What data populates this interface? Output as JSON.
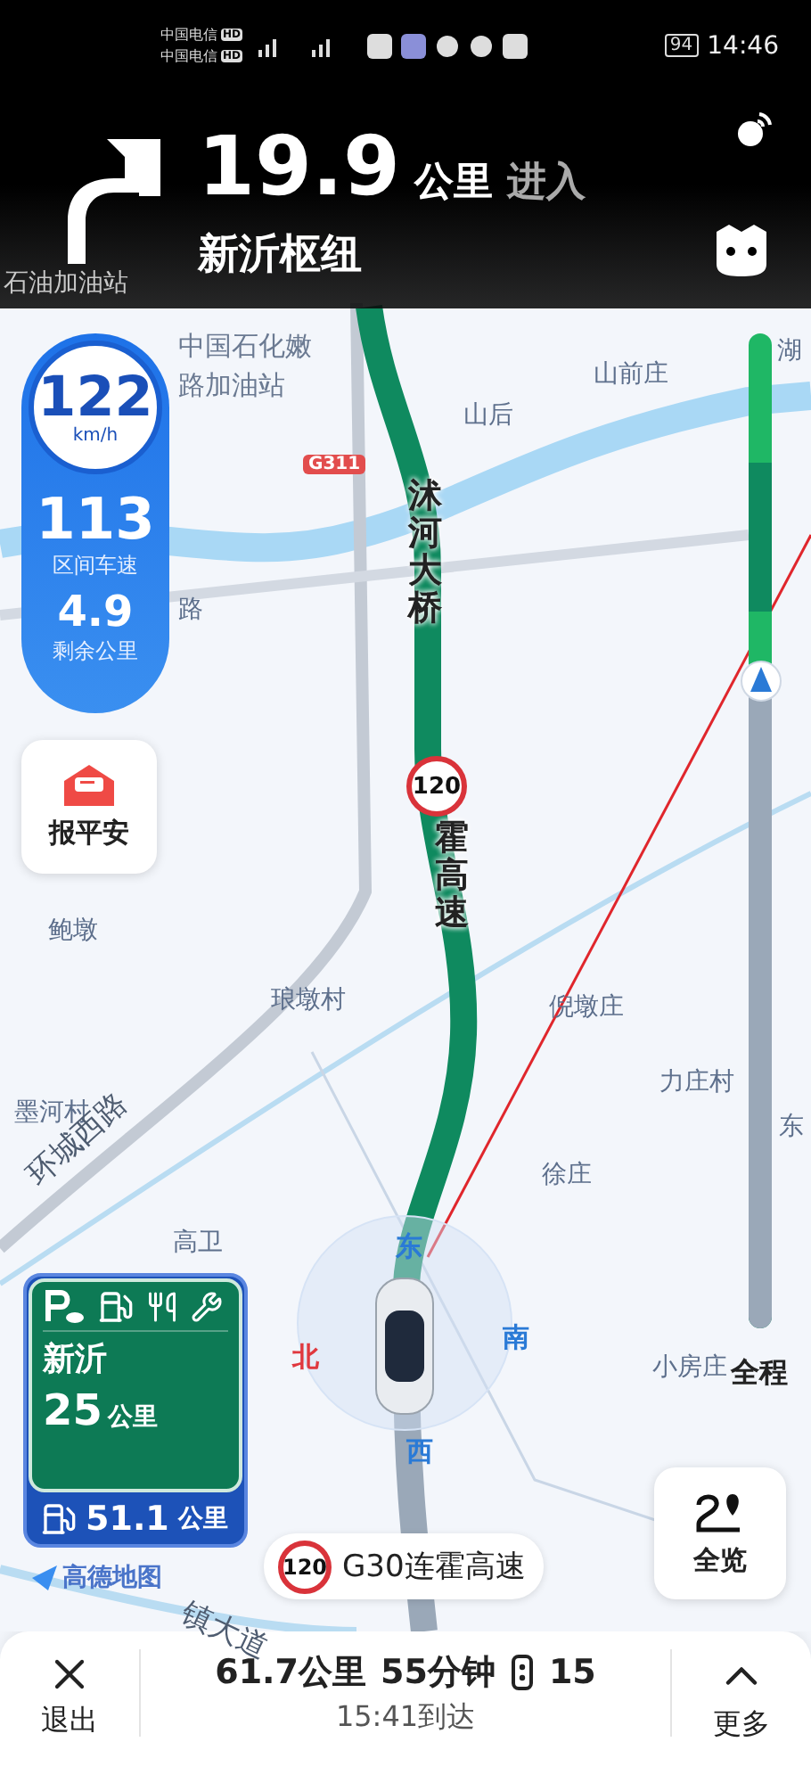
{
  "status_bar": {
    "carriers": [
      "中国电信",
      "中国电信"
    ],
    "hd_badges": [
      "HD",
      "HD"
    ],
    "battery": "94",
    "time": "14:46"
  },
  "guidance": {
    "distance": "19.9",
    "unit": "公里",
    "action": "进入",
    "road": "新沂枢纽"
  },
  "speed_panel": {
    "speed": "122",
    "speed_unit": "km/h",
    "average_speed": "113",
    "average_label": "区间车速",
    "remaining": "4.9",
    "remaining_label": "剩余公里"
  },
  "safety_button": {
    "label": "报平安"
  },
  "map_labels": [
    {
      "text": "石油加油站",
      "kind": "place"
    },
    {
      "text": "中国石化嫩路加油站",
      "kind": "poi"
    },
    {
      "text": "山前庄",
      "kind": "place"
    },
    {
      "text": "山后",
      "kind": "place"
    },
    {
      "text": "湖",
      "kind": "place"
    },
    {
      "text": "路",
      "kind": "place"
    },
    {
      "text": "鲍墩",
      "kind": "place"
    },
    {
      "text": "琅墩村",
      "kind": "place"
    },
    {
      "text": "倪墩庄",
      "kind": "place"
    },
    {
      "text": "力庄村",
      "kind": "place"
    },
    {
      "text": "东",
      "kind": "place"
    },
    {
      "text": "墨河村",
      "kind": "place"
    },
    {
      "text": "徐庄",
      "kind": "place"
    },
    {
      "text": "高卫",
      "kind": "place"
    },
    {
      "text": "小房庄",
      "kind": "place"
    },
    {
      "text": "环城西路",
      "kind": "road"
    },
    {
      "text": "镇大道",
      "kind": "road"
    },
    {
      "text": "沭河大桥",
      "kind": "vertical"
    },
    {
      "text": "霍高速",
      "kind": "vertical"
    },
    {
      "text": "G311",
      "kind": "shield"
    }
  ],
  "speed_limit_marker": "120",
  "compass": [
    {
      "text": "东",
      "color": "#2a7ad6"
    },
    {
      "text": "北",
      "color": "#e0383e"
    },
    {
      "text": "南",
      "color": "#2a7ad6"
    },
    {
      "text": "西",
      "color": "#2a7ad6"
    }
  ],
  "service_sign": {
    "destination": "新沂",
    "distance": "25",
    "unit": "公里",
    "next_distance": "51.1",
    "next_unit": "公里"
  },
  "current_road": {
    "speed_limit": "120",
    "name": "G30连霍高速"
  },
  "overview_button": {
    "label": "全览"
  },
  "route_progress": {
    "label": "全程",
    "level": 0.65
  },
  "logo": "高德地图",
  "exit_button": {
    "label": "退出"
  },
  "trip": {
    "distance": "61.7公里",
    "duration": "55分钟",
    "traffic_lights": "15",
    "arrival": "15:41到达"
  },
  "more_button": {
    "label": "更多"
  }
}
